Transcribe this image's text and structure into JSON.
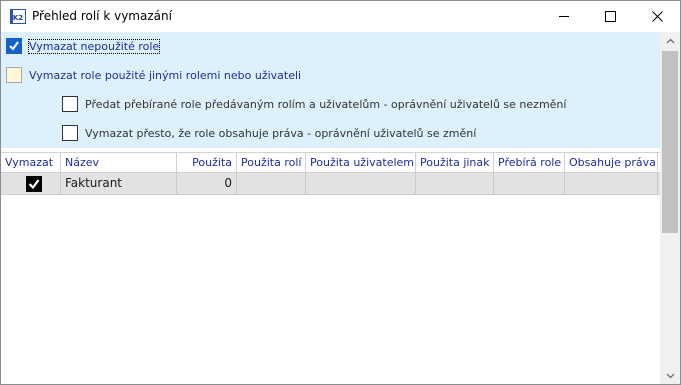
{
  "window": {
    "title": "Přehled rolí k vymazání",
    "app_icon_text": "K2"
  },
  "options": {
    "delete_unused": {
      "label": "Vymazat nepoužité role",
      "checked": true
    },
    "delete_used_by_others": {
      "label": "Vymazat role použité jinými rolemi nebo uživateli",
      "checked": false
    },
    "transfer_roles": {
      "label": "Předat přebírané role předávaným rolím a uživatelům - oprávnění uživatelů se nezmění",
      "checked": false
    },
    "delete_with_rights": {
      "label": "Vymazat přesto, že role obsahuje práva - oprávnění uživatelů se změní",
      "checked": false
    }
  },
  "grid": {
    "columns": [
      "Vymazat",
      "Název",
      "Použita",
      "Použita rolí",
      "Použita uživatelem",
      "Použita jinak",
      "Přebírá role",
      "Obsahuje práva"
    ],
    "rows": [
      {
        "vymazat": true,
        "nazev": "Fakturant",
        "pouzita": "0",
        "pouzita_roli": "",
        "pouzita_uzivatelem": "",
        "pouzita_jinak": "",
        "prebira_role": "",
        "obsahuje_prava": ""
      }
    ]
  },
  "colors": {
    "options_background": "#dcf1fb",
    "checkbox_checked": "#1560c9",
    "header_text": "#1b2f9c",
    "row_background": "#e2e2e2"
  }
}
